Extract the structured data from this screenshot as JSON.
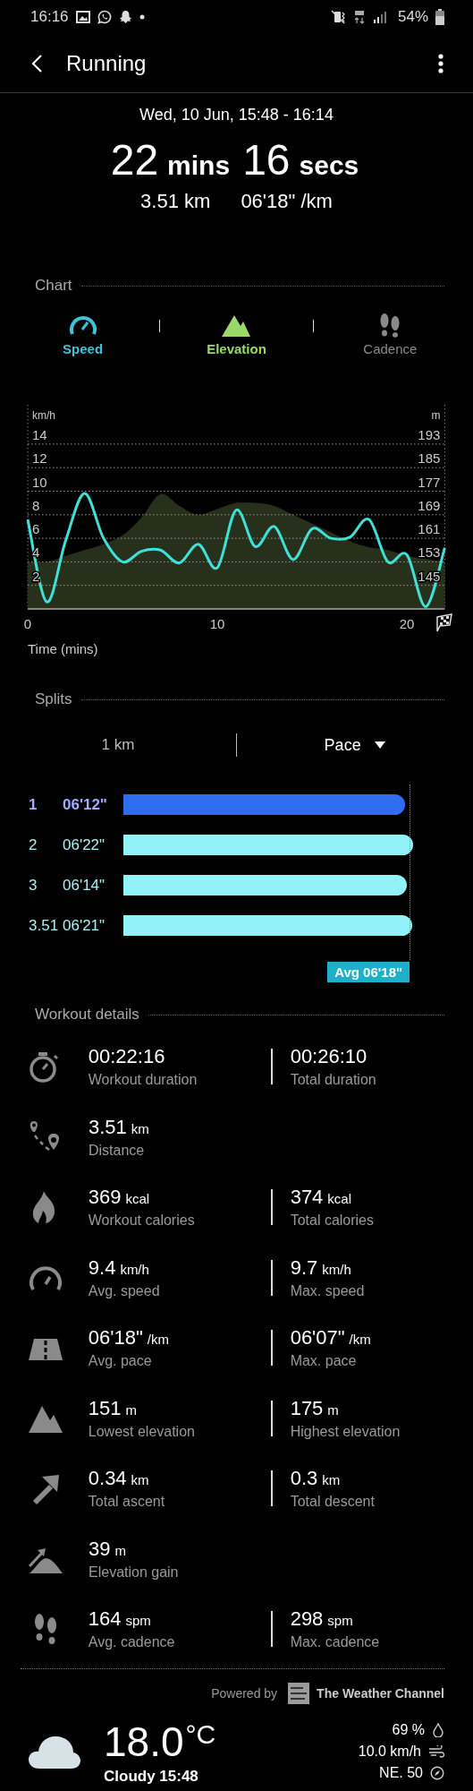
{
  "status_bar": {
    "time": "16:16",
    "battery": "54%"
  },
  "app_bar": {
    "title": "Running"
  },
  "summary": {
    "date": "Wed, 10 Jun, 15:48 - 16:14",
    "duration": [
      {
        "value": "22",
        "unit": "mins"
      },
      {
        "value": "16",
        "unit": "secs"
      }
    ],
    "distance": "3.51 km",
    "pace": "06'18\" /km"
  },
  "chart": {
    "header": "Chart",
    "tabs": [
      {
        "label": "Speed",
        "selected": true,
        "color": "#3cc4d6"
      },
      {
        "label": "Elevation",
        "selected": true,
        "color": "#9ad86a"
      },
      {
        "label": "Cadence",
        "selected": false,
        "color": "#8a8a8a"
      }
    ],
    "chart_data": {
      "type": "line",
      "xlabel": "Time (mins)",
      "ylabel": "km/h",
      "y2label": "m",
      "x": [
        0,
        1,
        2,
        3,
        4,
        5,
        6,
        7,
        8,
        9,
        10,
        11,
        12,
        13,
        14,
        15,
        16,
        17,
        18,
        19,
        20,
        21,
        22
      ],
      "grid": true,
      "xlim": [
        0,
        22
      ],
      "xticks": [
        0,
        10,
        20
      ],
      "ylim": [
        0,
        14
      ],
      "yticks": [
        2,
        4,
        6,
        8,
        10,
        12,
        14
      ],
      "y2lim": [
        137,
        193
      ],
      "y2ticks": [
        145,
        153,
        161,
        169,
        177,
        185,
        193
      ],
      "series": [
        {
          "type": "area",
          "color": "#26301a",
          "axis": "y2",
          "values": [
            153,
            153,
            155,
            157,
            159,
            162,
            168,
            176,
            172,
            169,
            171,
            173,
            173,
            172,
            169,
            166,
            163,
            160,
            158,
            157,
            155,
            154,
            153
          ]
        },
        {
          "color": "#3ee0d8",
          "values": [
            7.6,
            0.6,
            5.8,
            9.8,
            6.0,
            4.0,
            4.9,
            5.0,
            3.9,
            5.5,
            3.5,
            8.4,
            5.3,
            7.0,
            4.2,
            6.8,
            6.0,
            6.1,
            7.6,
            4.0,
            4.6,
            0.2,
            5.2
          ]
        }
      ]
    }
  },
  "splits": {
    "header": "Splits",
    "unit": "1 km",
    "metric": "Pace",
    "rows": [
      {
        "label": "1",
        "value": "06'12\"",
        "selected": true
      },
      {
        "label": "2",
        "value": "06'22\"",
        "selected": false
      },
      {
        "label": "3",
        "value": "06'14\"",
        "selected": false
      },
      {
        "label": "3.51",
        "value": "06'21\"",
        "selected": false
      }
    ],
    "average": {
      "label": "Avg 06'18\""
    }
  },
  "workout_details": {
    "header": "Workout details",
    "rows": [
      {
        "left": {
          "value": "00:22:16",
          "label": "Workout duration"
        },
        "right": {
          "value": "00:26:10",
          "label": "Total duration"
        }
      },
      {
        "left": {
          "value": "3.51",
          "unit": "km",
          "label": "Distance"
        }
      },
      {
        "left": {
          "value": "369",
          "unit": "kcal",
          "label": "Workout calories"
        },
        "right": {
          "value": "374",
          "unit": "kcal",
          "label": "Total calories"
        }
      },
      {
        "left": {
          "value": "9.4",
          "unit": "km/h",
          "label": "Avg. speed"
        },
        "right": {
          "value": "9.7",
          "unit": "km/h",
          "label": "Max. speed"
        }
      },
      {
        "left": {
          "value": "06'18\"",
          "unit": "/km",
          "label": "Avg. pace"
        },
        "right": {
          "value": "06'07\"",
          "unit": "/km",
          "label": "Max. pace"
        }
      },
      {
        "left": {
          "value": "151",
          "unit": "m",
          "label": "Lowest elevation"
        },
        "right": {
          "value": "175",
          "unit": "m",
          "label": "Highest elevation"
        }
      },
      {
        "left": {
          "value": "0.34",
          "unit": "km",
          "label": "Total ascent"
        },
        "right": {
          "value": "0.3",
          "unit": "km",
          "label": "Total descent"
        }
      },
      {
        "left": {
          "value": "39",
          "unit": "m",
          "label": "Elevation gain"
        }
      },
      {
        "left": {
          "value": "164",
          "unit": "spm",
          "label": "Avg. cadence"
        },
        "right": {
          "value": "298",
          "unit": "spm",
          "label": "Max. cadence"
        }
      }
    ]
  },
  "weather": {
    "powered_by": "Powered by",
    "provider": "The Weather Channel",
    "temperature": "18.0",
    "temperature_unit": "°C",
    "condition": "Cloudy 15:48",
    "humidity": "69 %",
    "wind_speed": "10.0 km/h",
    "wind_direction": "NE. 50"
  }
}
